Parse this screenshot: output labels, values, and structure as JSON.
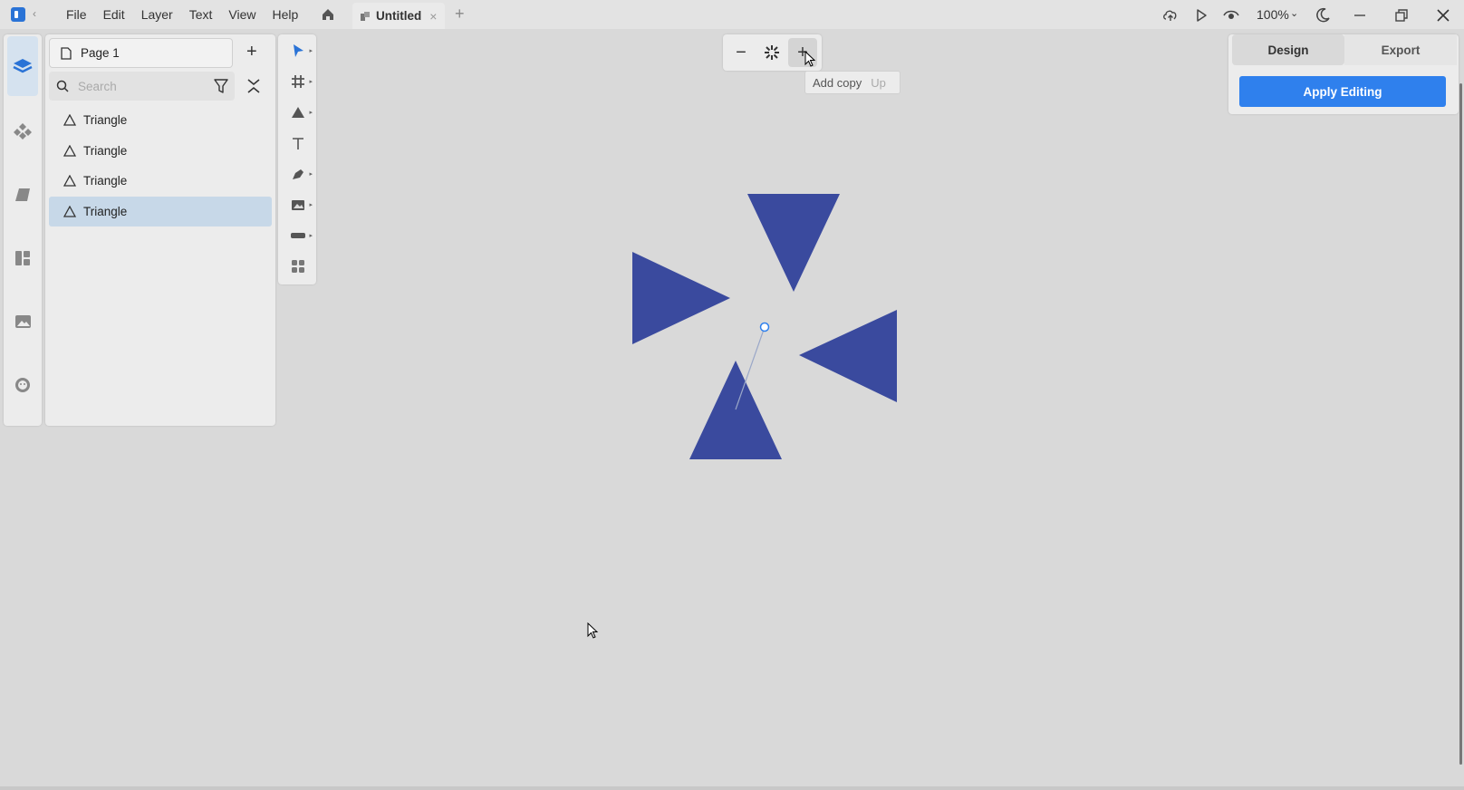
{
  "titlebar": {
    "menu": [
      "File",
      "Edit",
      "Layer",
      "Text",
      "View",
      "Help"
    ],
    "tab_title": "Untitled",
    "tab_close": "×",
    "tab_add": "+",
    "zoom": "100%"
  },
  "layers_panel": {
    "page_name": "Page 1",
    "search_placeholder": "Search",
    "layers": [
      {
        "label": "Triangle",
        "selected": false
      },
      {
        "label": "Triangle",
        "selected": false
      },
      {
        "label": "Triangle",
        "selected": false
      },
      {
        "label": "Triangle",
        "selected": true
      }
    ]
  },
  "zoom_control": {
    "minus": "−",
    "plus": "+",
    "tooltip_action": "Add copy",
    "tooltip_shortcut": "Up"
  },
  "right_panel": {
    "tabs": [
      "Design",
      "Export"
    ],
    "apply_label": "Apply Editing"
  },
  "colors": {
    "accent": "#2f80ed",
    "shape_fill": "#3a4a9e",
    "selected_row": "#c7d8e8"
  },
  "icons": {
    "rail": [
      "layers-icon",
      "components-icon",
      "shapes-icon",
      "library-icon",
      "image-icon",
      "plugins-icon"
    ],
    "tools": [
      "select-icon",
      "frame-icon",
      "shape-icon",
      "text-icon",
      "pen-icon",
      "image-icon",
      "component-icon",
      "plugins-icon"
    ]
  }
}
